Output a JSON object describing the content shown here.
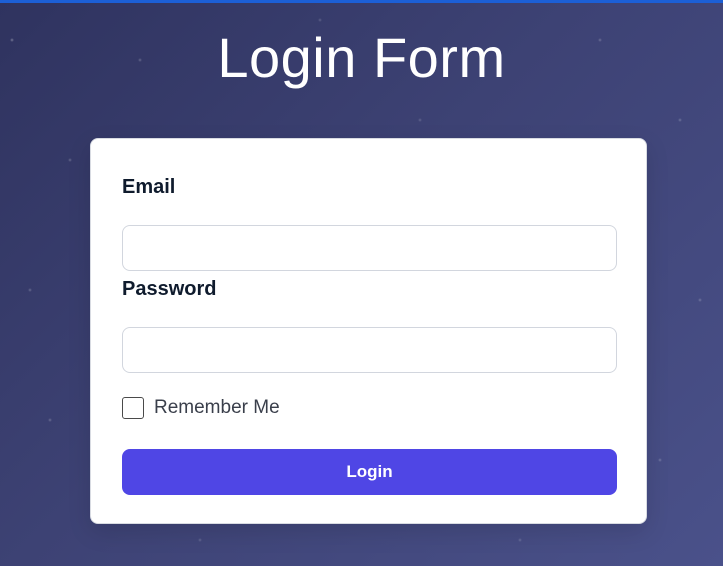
{
  "page": {
    "title": "Login Form"
  },
  "form": {
    "email_label": "Email",
    "email_value": "",
    "email_placeholder": "",
    "password_label": "Password",
    "password_value": "",
    "password_placeholder": "",
    "remember_label": "Remember Me",
    "remember_checked": false,
    "submit_label": "Login"
  },
  "colors": {
    "background_start": "#2f335f",
    "background_end": "#4a518a",
    "card_bg": "#ffffff",
    "accent": "#4f46e5",
    "top_accent_line": "#1c5fd6"
  }
}
